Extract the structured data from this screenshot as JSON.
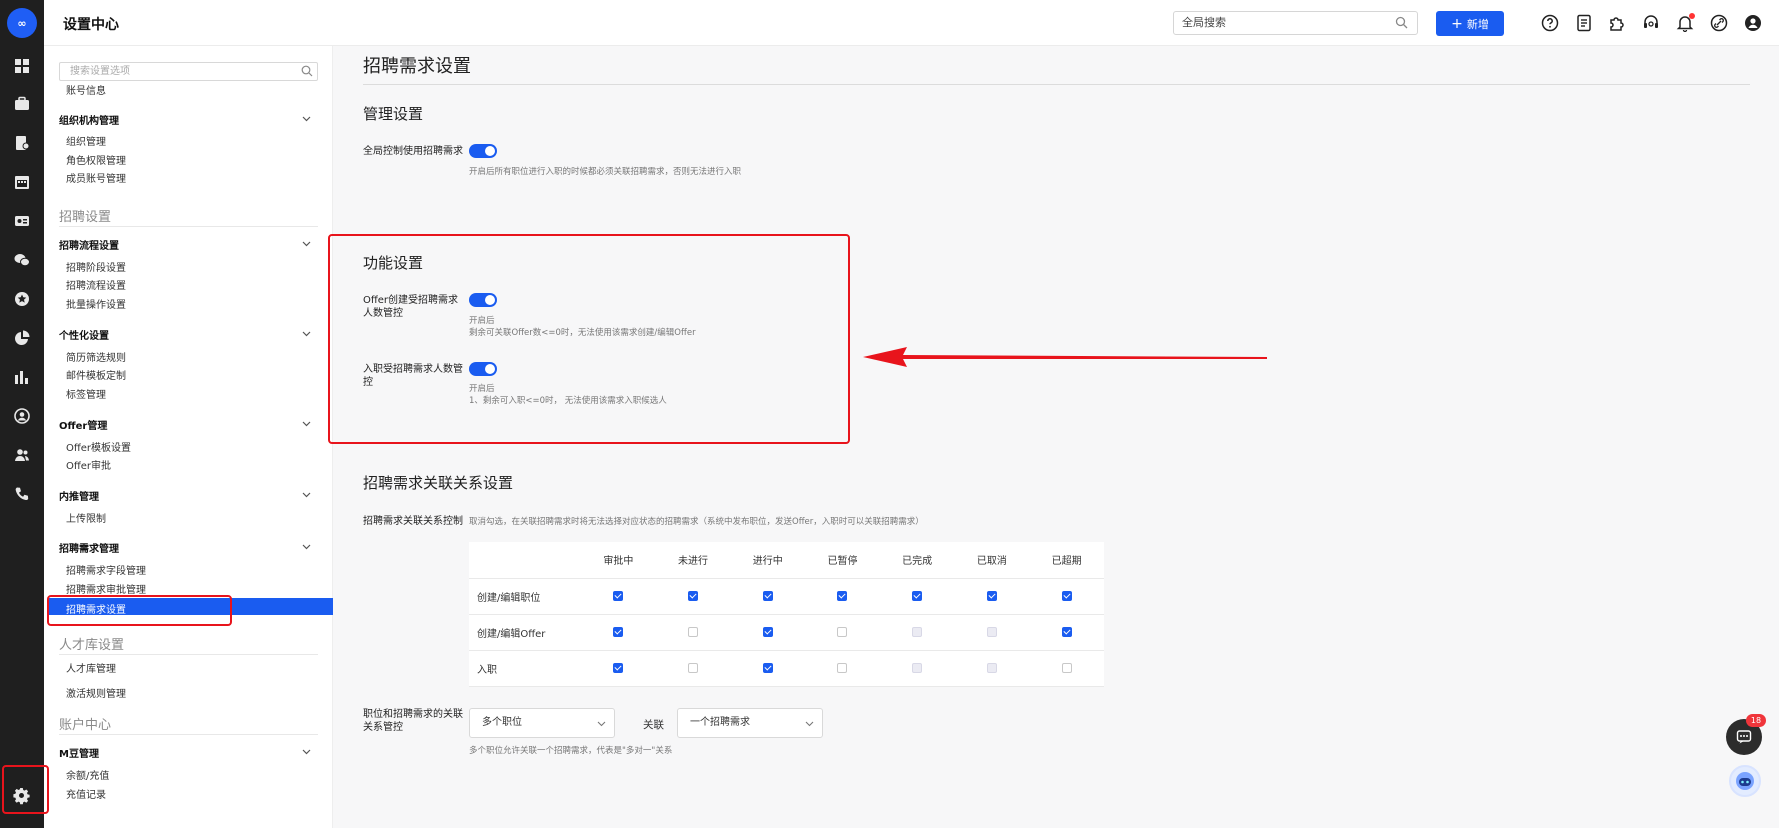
{
  "rail": {
    "logo_text": "∞",
    "icons": [
      "dashboard-icon",
      "briefcase-icon",
      "resume-doc-icon",
      "calendar-icon",
      "id-card-icon",
      "wechat-icon",
      "star-badge-icon",
      "pie-chart-icon",
      "bar-chart-icon",
      "person-circle-icon",
      "team-icon",
      "phone-icon"
    ],
    "settings_icon": "gear-icon"
  },
  "header": {
    "title": "设置中心",
    "search_placeholder": "全局搜索",
    "new_button": "新增",
    "icons": [
      "help-icon",
      "document-icon",
      "plugin-icon",
      "service-icon",
      "bell-icon",
      "link-icon",
      "user-icon"
    ]
  },
  "sidebar": {
    "search_placeholder": "搜索设置选项",
    "top_item": "账号信息",
    "groups": {
      "org": {
        "title": "组织机构管理",
        "items": [
          "组织管理",
          "角色权限管理",
          "成员账号管理"
        ]
      },
      "recruit_section": "招聘设置",
      "flow": {
        "title": "招聘流程设置",
        "items": [
          "招聘阶段设置",
          "招聘流程设置",
          "批量操作设置"
        ]
      },
      "custom": {
        "title": "个性化设置",
        "items": [
          "简历筛选规则",
          "邮件模板定制",
          "标签管理"
        ]
      },
      "offer": {
        "title": "Offer管理",
        "items": [
          "Offer模板设置",
          "Offer审批"
        ]
      },
      "referral": {
        "title": "内推管理",
        "items": [
          "上传限制"
        ]
      },
      "demand": {
        "title": "招聘需求管理",
        "items": [
          "招聘需求字段管理",
          "招聘需求审批管理"
        ],
        "active": "招聘需求设置"
      },
      "talent_section": "人才库设置",
      "talent_items": [
        "人才库管理",
        "激活规则管理"
      ],
      "account_section": "账户中心",
      "mbean": {
        "title": "M豆管理",
        "items": [
          "余额/充值",
          "充值记录"
        ]
      }
    }
  },
  "main": {
    "page_title": "招聘需求设置",
    "manage": {
      "title": "管理设置",
      "global_label": "全局控制使用招聘需求",
      "global_desc": "开启后所有职位进行入职的时候都必须关联招聘需求，否则无法进行入职",
      "global_on": true
    },
    "feature": {
      "title": "功能设置",
      "offer_label": "Offer创建受招聘需求人数管控",
      "offer_desc_1": "开启后",
      "offer_desc_2": "剩余可关联Offer数<=0时，无法使用该需求创建/编辑Offer",
      "offer_on": true,
      "onboard_label": "入职受招聘需求人数管控",
      "onboard_desc_1": "开启后",
      "onboard_desc_2": "1、剩余可入职<=0时， 无法使用该需求入职候选人",
      "onboard_on": true
    },
    "relation": {
      "title": "招聘需求关联关系设置",
      "control_label": "招聘需求关联关系控制",
      "control_desc": "取消勾选，在关联招聘需求时将无法选择对应状态的招聘需求（系统中发布职位，发送Offer，入职时可以关联招聘需求）",
      "columns": [
        "审批中",
        "未进行",
        "进行中",
        "已暂停",
        "已完成",
        "已取消",
        "已超期"
      ],
      "rows": [
        {
          "name": "创建/编辑职位",
          "cells": [
            "on",
            "on",
            "on",
            "on",
            "on",
            "on",
            "on"
          ]
        },
        {
          "name": "创建/编辑Offer",
          "cells": [
            "on",
            "off",
            "on",
            "off",
            "dis",
            "dis",
            "on"
          ]
        },
        {
          "name": "入职",
          "cells": [
            "on",
            "off",
            "on",
            "off",
            "dis",
            "dis",
            "off"
          ]
        }
      ],
      "position_label": "职位和招聘需求的关联关系管控",
      "select_left": "多个职位",
      "connector": "关联",
      "select_right": "一个招聘需求",
      "position_desc": "多个职位允许关联一个招聘需求，代表是\"多对一\"关系"
    }
  },
  "floating": {
    "chat_badge": "18"
  },
  "colors": {
    "accent": "#1a5cf0",
    "annotation": "#e8141c",
    "rail": "#1f1f1f"
  }
}
